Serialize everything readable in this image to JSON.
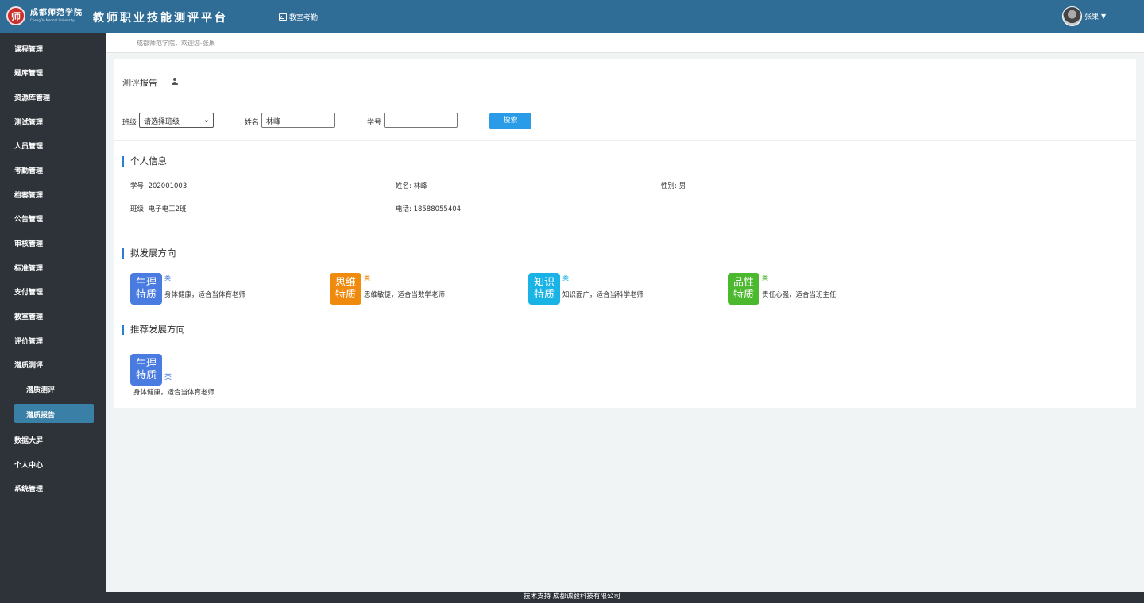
{
  "header": {
    "logo_seal": "师",
    "school_name_cn": "成都师范学院",
    "school_name_en": "ChengDu Normal University",
    "platform_title": "教师职业技能测评平台",
    "nav_link": "教室考勤",
    "user_name": "张果",
    "caret": "▼"
  },
  "sidebar": {
    "items": [
      "课程管理",
      "题库管理",
      "资源库管理",
      "测试管理",
      "人员管理",
      "考勤管理",
      "档案管理",
      "公告管理",
      "审核管理",
      "标准管理",
      "支付管理",
      "教室管理",
      "评价管理",
      "潜质测评"
    ],
    "sub_items": [
      "潜质测评",
      "潜质报告"
    ],
    "active_sub": "潜质报告",
    "bottom_items": [
      "数据大屏",
      "个人中心",
      "系统管理"
    ]
  },
  "breadcrumb": "成都师范学院，欢迎您-张果",
  "page": {
    "title": "测评报告",
    "filters": {
      "class_label": "班级",
      "class_value": "请选择班级",
      "name_label": "姓名",
      "name_value": "林峰",
      "id_label": "学号",
      "id_value": "",
      "search_button": "搜索"
    },
    "personal_info": {
      "section_title": "个人信息",
      "student_id": "学号: 202001003",
      "name": "姓名: 林峰",
      "gender": "性别: 男",
      "class": "班级: 电子电工2班",
      "phone": "电话: 18588055404"
    },
    "planned": {
      "section_title": "拟发展方向",
      "traits": [
        {
          "line1": "生理",
          "line2": "特质",
          "cat": "类",
          "desc": "身体健康，适合当体育老师",
          "color": "#4a7be0"
        },
        {
          "line1": "思维",
          "line2": "特质",
          "cat": "类",
          "desc": "思维敏捷，适合当数学老师",
          "color": "#f08a0c"
        },
        {
          "line1": "知识",
          "line2": "特质",
          "cat": "类",
          "desc": "知识面广，适合当科学老师",
          "color": "#1ab3e6"
        },
        {
          "line1": "品性",
          "line2": "特质",
          "cat": "类",
          "desc": "责任心强，适合当班主任",
          "color": "#4cb82e"
        }
      ]
    },
    "recommended": {
      "section_title": "推荐发展方向",
      "trait": {
        "line1": "生理",
        "line2": "特质",
        "cat": "类",
        "desc": "身体健康，适合当体育老师",
        "color": "#4a7be0"
      }
    }
  },
  "footer": "技术支持 成都诚毅科技有限公司"
}
